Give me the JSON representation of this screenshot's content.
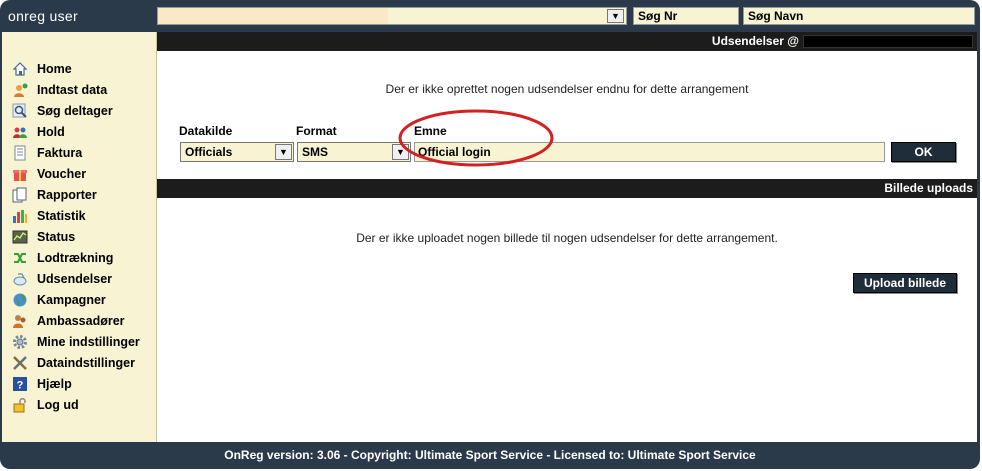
{
  "app": {
    "user_label": "onreg user"
  },
  "search": {
    "nr_label": "Søg Nr",
    "name_label": "Søg Navn"
  },
  "sidebar": {
    "items": [
      {
        "label": "Home",
        "icon": "home-icon"
      },
      {
        "label": "Indtast data",
        "icon": "user-add-icon"
      },
      {
        "label": "Søg deltager",
        "icon": "magnifier-icon"
      },
      {
        "label": "Hold",
        "icon": "team-icon"
      },
      {
        "label": "Faktura",
        "icon": "invoice-icon"
      },
      {
        "label": "Voucher",
        "icon": "gift-icon"
      },
      {
        "label": "Rapporter",
        "icon": "reports-icon"
      },
      {
        "label": "Statistik",
        "icon": "bar-chart-icon"
      },
      {
        "label": "Status",
        "icon": "status-icon"
      },
      {
        "label": "Lodtrækning",
        "icon": "shuffle-icon"
      },
      {
        "label": "Udsendelser",
        "icon": "broadcast-icon"
      },
      {
        "label": "Kampagner",
        "icon": "globe-icon"
      },
      {
        "label": "Ambassadører",
        "icon": "ambassadors-icon"
      },
      {
        "label": "Mine indstillinger",
        "icon": "gear-icon"
      },
      {
        "label": "Dataindstillinger",
        "icon": "tools-icon"
      },
      {
        "label": "Hjælp",
        "icon": "help-icon"
      },
      {
        "label": "Log ud",
        "icon": "lock-icon"
      }
    ]
  },
  "udsendelser": {
    "header": "Udsendelser @",
    "empty_message": "Der er ikke oprettet nogen udsendelser endnu for dette arrangement",
    "datakilde_label": "Datakilde",
    "datakilde_value": "Officials",
    "format_label": "Format",
    "format_value": "SMS",
    "emne_label": "Emne",
    "emne_value": "Official login",
    "ok_label": "OK"
  },
  "billede": {
    "header": "Billede uploads",
    "empty_message": "Der er ikke uploadet nogen billede til nogen udsendelser for dette arrangement.",
    "upload_label": "Upload billede"
  },
  "footer": {
    "text": "OnReg version: 3.06 - Copyright: Ultimate Sport Service - Licensed to: Ultimate Sport Service"
  },
  "colors": {
    "frame": "#2a3a4a",
    "sidebar_bg": "#f7f3d3",
    "section_bar": "#1c1c1c",
    "highlight": "#d42020",
    "button": "#1f2d3a"
  }
}
